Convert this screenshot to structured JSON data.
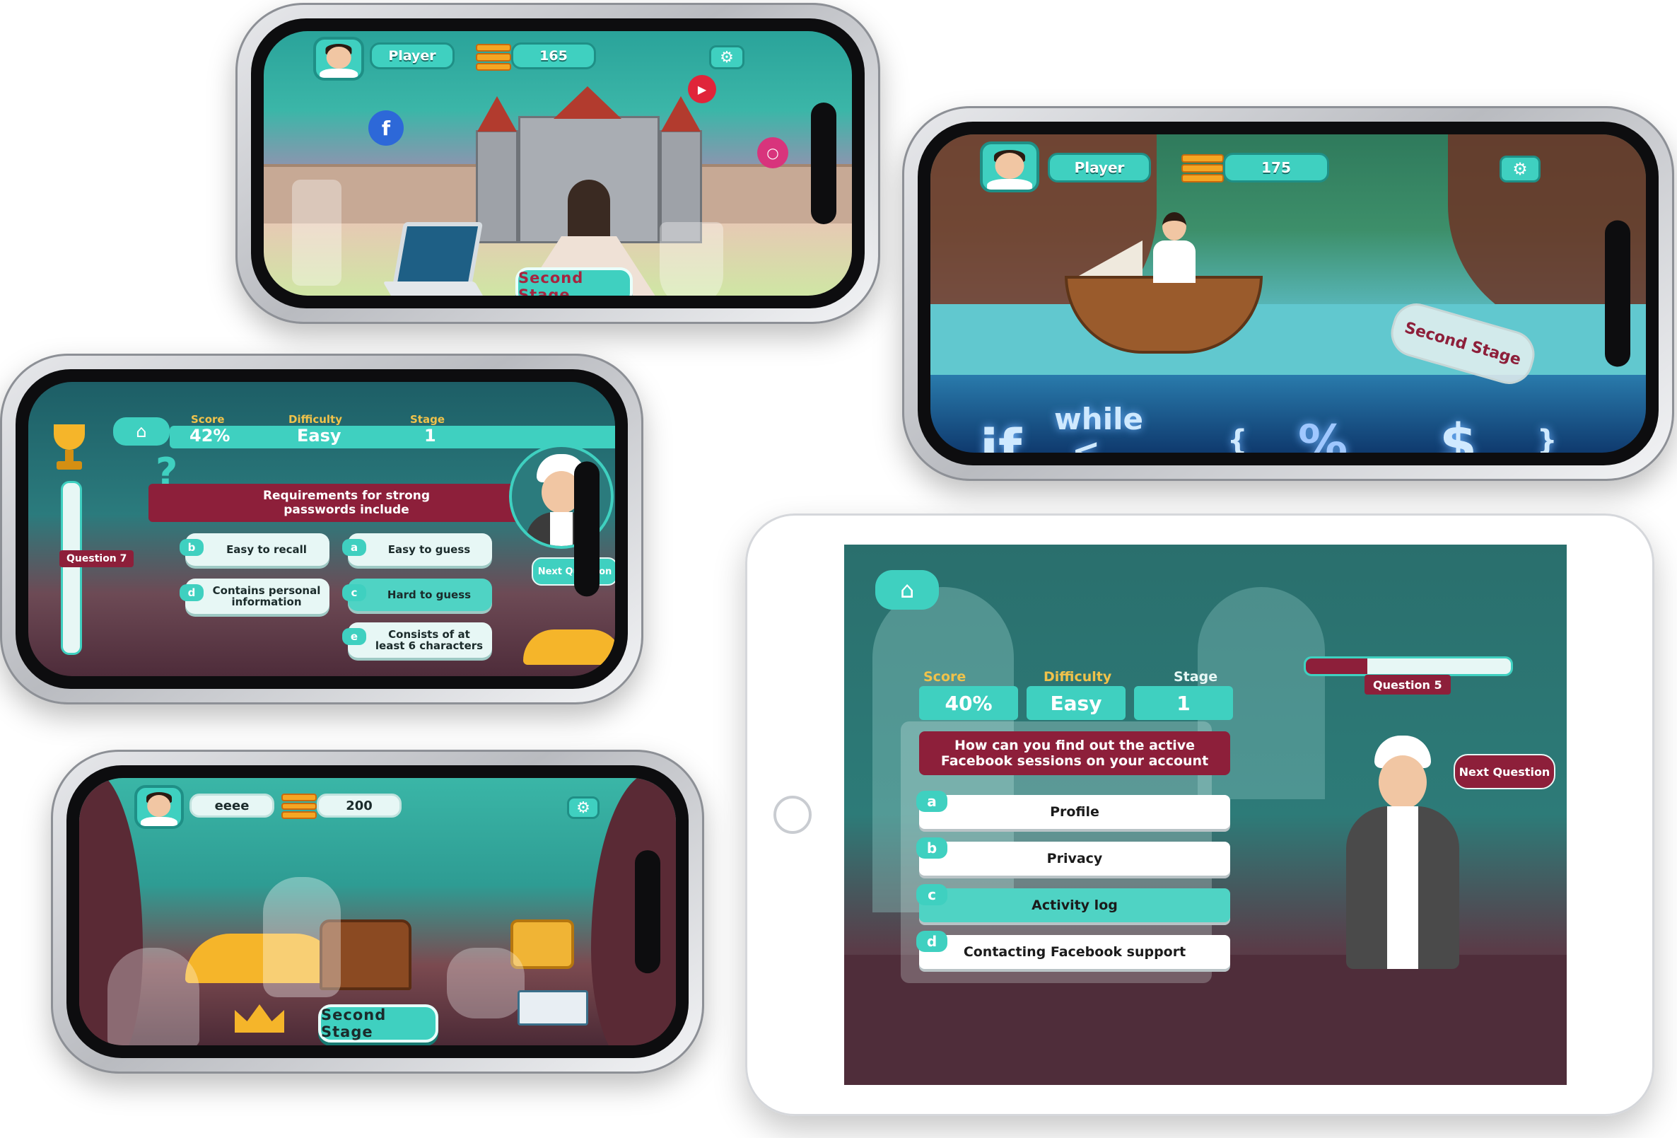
{
  "phone1": {
    "player_name": "Player",
    "coins": "165",
    "stage_button": "Second Stage",
    "social_icons": [
      "facebook-icon",
      "youtube-icon",
      "instagram-icon"
    ]
  },
  "phone2": {
    "player_name": "Player",
    "coins": "175",
    "bottle_label": "Second Stage",
    "code_words": [
      "if",
      "while",
      "<",
      "{",
      "%",
      "$",
      "}"
    ]
  },
  "phone3": {
    "labels": {
      "score": "Score",
      "difficulty": "Difficulty",
      "stage": "Stage"
    },
    "values": {
      "score": "42%",
      "difficulty": "Easy",
      "stage": "1"
    },
    "question": "Requirements for strong passwords include",
    "question_number": "Question 7",
    "next_button": "Next Question",
    "answers": [
      {
        "letter": "b",
        "text": "Easy to recall"
      },
      {
        "letter": "a",
        "text": "Easy to guess"
      },
      {
        "letter": "d",
        "text": "Contains personal information"
      },
      {
        "letter": "c",
        "text": "Hard to guess"
      },
      {
        "letter": "e",
        "text": "Consists of at least 6 characters"
      }
    ]
  },
  "phone4": {
    "player_name": "eeee",
    "coins": "200",
    "stage_button": "Second Stage"
  },
  "tablet": {
    "labels": {
      "score": "Score",
      "difficulty": "Difficulty",
      "stage": "Stage"
    },
    "values": {
      "score": "40%",
      "difficulty": "Easy",
      "stage": "1"
    },
    "question": "How can you find out the active Facebook sessions on your account",
    "question_number": "Question 5",
    "next_button": "Next Question",
    "answers": [
      {
        "letter": "a",
        "text": "Profile"
      },
      {
        "letter": "b",
        "text": "Privacy"
      },
      {
        "letter": "c",
        "text": "Activity log"
      },
      {
        "letter": "d",
        "text": "Contacting Facebook support"
      }
    ]
  },
  "colors": {
    "accent": "#3fd0c0",
    "accent_dark": "#1f8f86",
    "maroon": "#8d1f3a",
    "coin": "#f5a623"
  }
}
